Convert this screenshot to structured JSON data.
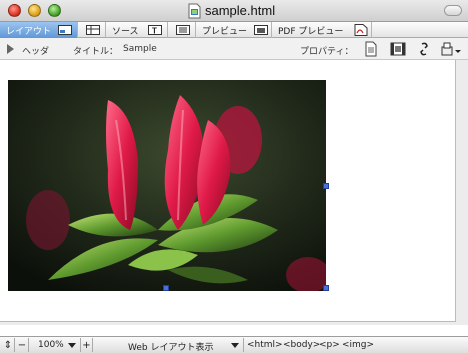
{
  "window": {
    "title": "sample.html"
  },
  "tabs": [
    {
      "label": "レイアウト",
      "icon": "layout-view-icon",
      "active": true
    },
    {
      "label": "",
      "icon": "table-view-icon",
      "active": false
    },
    {
      "label": "ソース",
      "icon": "source-text-icon",
      "active": false
    },
    {
      "label": "",
      "icon": "split-view-icon",
      "active": false
    },
    {
      "label": "プレビュー",
      "icon": "preview-image-icon",
      "active": false
    },
    {
      "label": "PDF プレビュー",
      "icon": "pdf-icon",
      "active": false
    }
  ],
  "propbar": {
    "header_label": "ヘッダ",
    "title_label": "タイトル：",
    "title_value": "Sample",
    "properties_label": "プロパティ："
  },
  "statusbar": {
    "zoom": "100%",
    "view_mode": "Web レイアウト表示",
    "breadcrumb": [
      "<html>",
      "<body>",
      "<p>",
      "<img>"
    ]
  },
  "colors": {
    "active_tab": "#5f97d6",
    "selection_handle": "#4a6fd8"
  }
}
